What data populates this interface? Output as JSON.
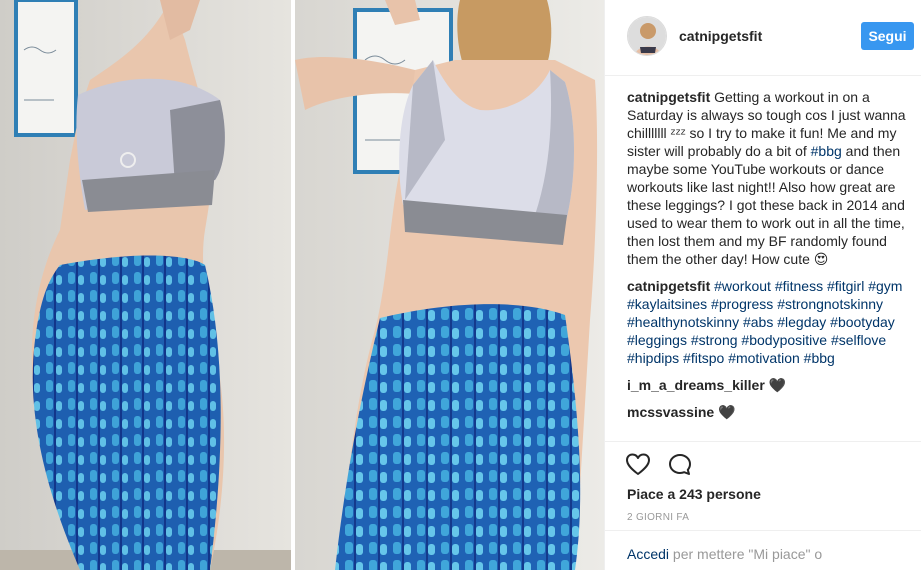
{
  "colors": {
    "accent": "#3897f0",
    "link": "#003569",
    "muted": "#999999"
  },
  "header": {
    "username": "catnipgetsfit",
    "follow_label": "Segui"
  },
  "caption": {
    "user": "catnipgetsfit",
    "text_1": " Getting a workout in on a Saturday is always so tough cos I just wanna chilllllll ᶻᶻᶻ so I try to make it fun! Me and my sister will probably do a bit of ",
    "hashtag": "#bbg",
    "text_2": " and then maybe some YouTube workouts or dance workouts like last night!! Also how great are these leggings? I got these back in 2014 and used to wear them to work out in all the time, then lost them and my BF randomly found them the other day! How cute 😍"
  },
  "hashtag_comment": {
    "user": "catnipgetsfit",
    "tags": [
      "#workout",
      "#fitness",
      "#fitgirl",
      "#gym",
      "#kaylaitsines",
      "#progress",
      "#strongnotskinny",
      "#healthynotskinny",
      "#abs",
      "#legday",
      "#bootyday",
      "#leggings",
      "#strong",
      "#bodypositive",
      "#selflove",
      "#hipdips",
      "#fitspo",
      "#motivation",
      "#bbg"
    ]
  },
  "comments": [
    {
      "user": "i_m_a_dreams_killer",
      "text": " 🖤"
    },
    {
      "user": "mcssvassine",
      "text": " 🖤"
    }
  ],
  "actions": {
    "heart_icon": "heart-outline-icon",
    "comment_icon": "comment-bubble-icon"
  },
  "likes": "Piace a 243 persone",
  "timestamp": "2 GIORNI FA",
  "login": {
    "link": "Accedi",
    "text": " per mettere \"Mi piace\" o"
  }
}
